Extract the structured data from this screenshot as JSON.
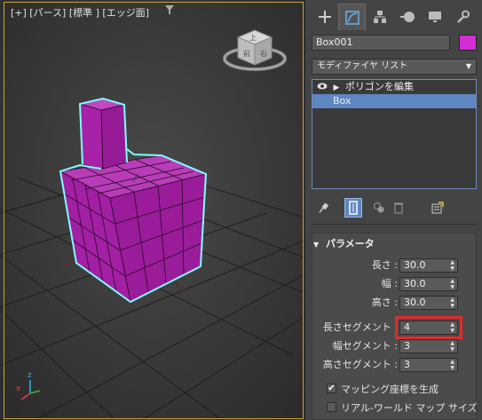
{
  "viewport": {
    "label": "[+] [パース] [標準 ] [エッジ面]",
    "filter_icon": "funnel-icon",
    "viewcube_labels": {
      "top": "上",
      "front": "前",
      "right": "右"
    }
  },
  "command_panel": {
    "tabs": [
      {
        "name": "create",
        "icon": "plus-icon"
      },
      {
        "name": "modify",
        "icon": "modify-icon",
        "active": true
      },
      {
        "name": "hierarchy",
        "icon": "hierarchy-icon"
      },
      {
        "name": "motion",
        "icon": "motion-icon"
      },
      {
        "name": "display",
        "icon": "display-icon"
      },
      {
        "name": "utilities",
        "icon": "wrench-icon"
      }
    ],
    "object_name": "Box001",
    "object_color": "#d22ed4",
    "modifier_list_label": "モディファイヤ リスト",
    "stack": {
      "item_edit_poly": "ポリゴンを編集",
      "item_box": "Box"
    },
    "rollout": {
      "title": "パラメータ",
      "length_label": "長さ :",
      "length_value": "30.0",
      "width_label": "幅 :",
      "width_value": "30.0",
      "height_label": "高さ :",
      "height_value": "30.0",
      "length_segs_label": "長さセグメント :",
      "length_segs_value": "4",
      "width_segs_label": "幅セグメント :",
      "width_segs_value": "3",
      "height_segs_label": "高さセグメント :",
      "height_segs_value": "3",
      "gen_mapping_label": "マッピング座標を生成",
      "gen_mapping_checked": true,
      "real_world_label": "リアル-ワールド マップ サイズ",
      "real_world_checked": false
    }
  },
  "colors": {
    "accent": "#5e86c0",
    "highlight": "#e32b2b",
    "mesh": "#b51fb4",
    "selection_outline": "#7fffff"
  }
}
